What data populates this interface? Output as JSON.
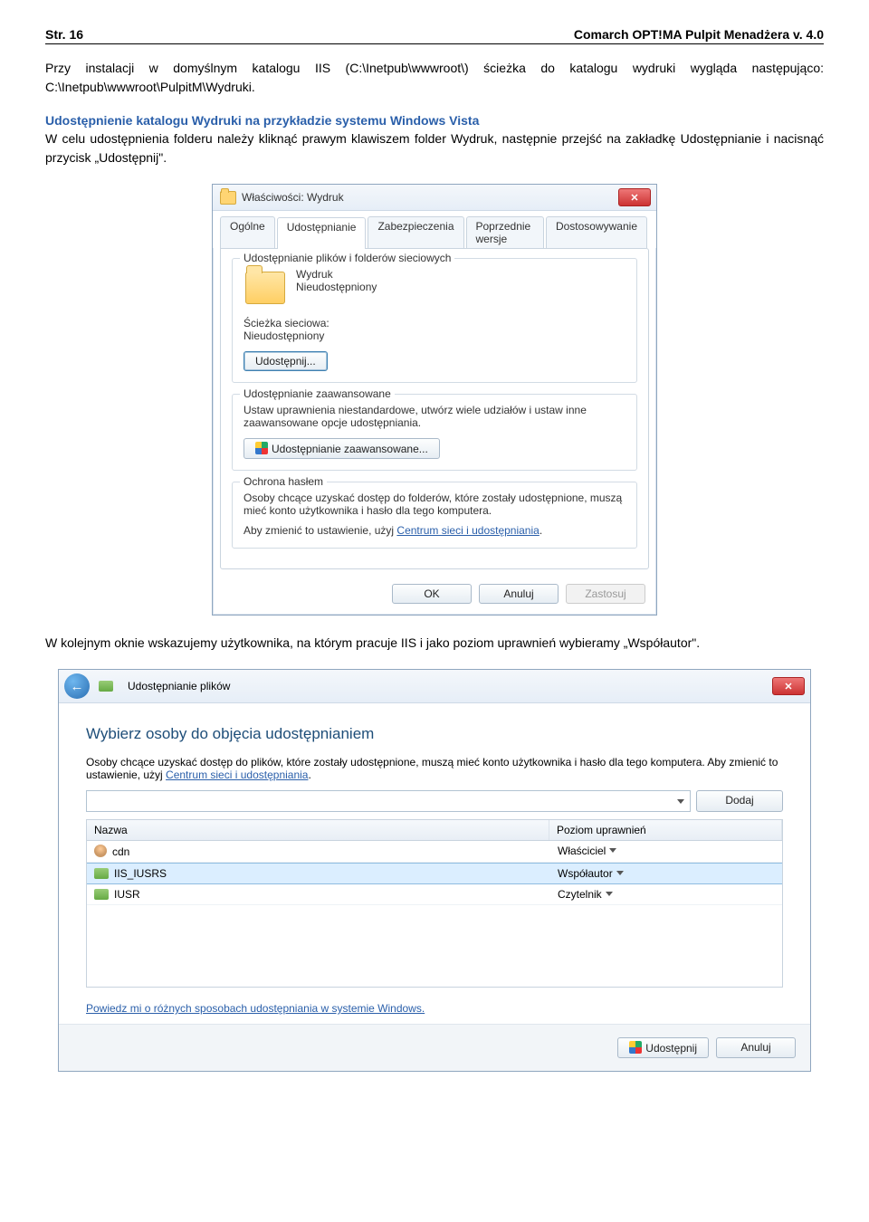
{
  "header": {
    "left": "Str. 16",
    "right": "Comarch OPT!MA Pulpit Menadżera v. 4.0"
  },
  "intro": "Przy instalacji w domyślnym katalogu IIS (C:\\Inetpub\\wwwroot\\) ścieżka do katalogu wydruki wygląda następująco: C:\\Inetpub\\wwwroot\\PulpitM\\Wydruki.",
  "section_title": "Udostępnienie katalogu Wydruki na przykładzie systemu Windows Vista",
  "section_body": "W celu udostępnienia folderu należy kliknąć prawym klawiszem folder Wydruk, następnie przejść na zakładkę Udostępnianie i nacisnąć przycisk „Udostępnij\".",
  "dlg1": {
    "title": "Właściwości: Wydruk",
    "tabs": [
      "Ogólne",
      "Udostępnianie",
      "Zabezpieczenia",
      "Poprzednie wersje",
      "Dostosowywanie"
    ],
    "group1": {
      "legend": "Udostępnianie plików i folderów sieciowych",
      "name": "Wydruk",
      "status": "Nieudostępniony",
      "path_label": "Ścieżka sieciowa:",
      "path_value": "Nieudostępniony",
      "share_btn": "Udostępnij..."
    },
    "group2": {
      "legend": "Udostępnianie zaawansowane",
      "text": "Ustaw uprawnienia niestandardowe, utwórz wiele udziałów i ustaw inne zaawansowane opcje udostępniania.",
      "btn": "Udostępnianie zaawansowane..."
    },
    "group3": {
      "legend": "Ochrona hasłem",
      "text1": "Osoby chcące uzyskać dostęp do folderów, które zostały udostępnione, muszą mieć konto użytkownika i hasło dla tego komputera.",
      "text2_a": "Aby zmienić to ustawienie, użyj ",
      "link": "Centrum sieci i udostępniania",
      "text2_b": "."
    },
    "ok": "OK",
    "cancel": "Anuluj",
    "apply": "Zastosuj"
  },
  "mid_text": "W kolejnym oknie wskazujemy użytkownika, na którym pracuje IIS i jako poziom uprawnień wybieramy „Współautor\".",
  "dlg2": {
    "bar_title": "Udostępnianie plików",
    "heading": "Wybierz osoby do objęcia udostępnianiem",
    "desc_a": "Osoby chcące uzyskać dostęp do plików, które zostały udostępnione, muszą mieć konto użytkownika i hasło dla tego komputera. Aby zmienić to ustawienie, użyj ",
    "desc_link": "Centrum sieci i udostępniania",
    "desc_b": ".",
    "add_btn": "Dodaj",
    "col1": "Nazwa",
    "col2": "Poziom uprawnień",
    "rows": [
      {
        "n": "cdn",
        "p": "Właściciel"
      },
      {
        "n": "IIS_IUSRS",
        "p": "Współautor"
      },
      {
        "n": "IUSR",
        "p": "Czytelnik"
      }
    ],
    "footer_link": "Powiedz mi o różnych sposobach udostępniania w systemie Windows.",
    "share_btn": "Udostępnij",
    "cancel_btn": "Anuluj"
  }
}
